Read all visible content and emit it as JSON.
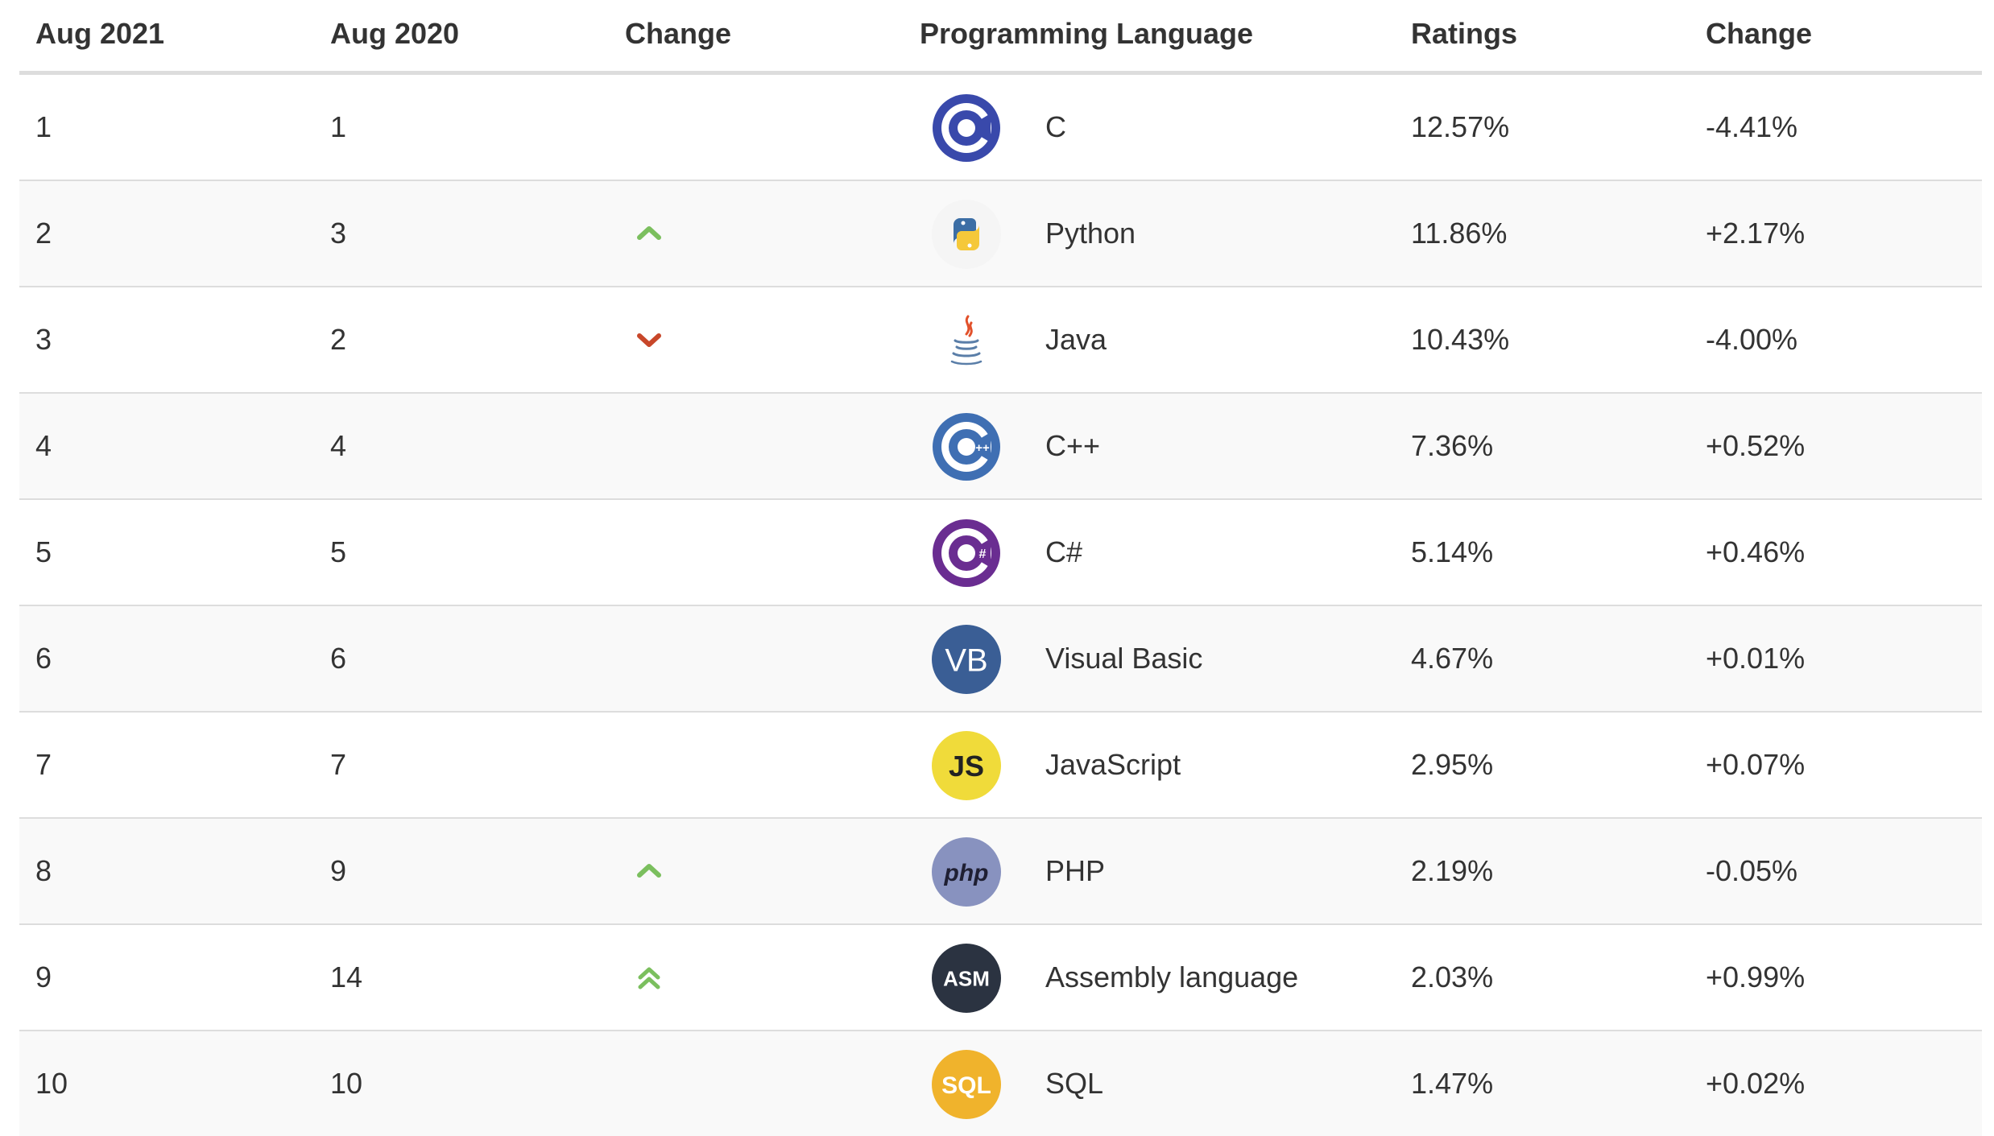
{
  "headers": {
    "col1": "Aug 2021",
    "col2": "Aug 2020",
    "col3": "Change",
    "col4": "Programming Language",
    "col5": "Ratings",
    "col6": "Change"
  },
  "colors": {
    "up": "#7bbf5e",
    "down": "#c8472a"
  },
  "rows": [
    {
      "rank": "1",
      "prev": "1",
      "change_icon": "none",
      "logo": "c-logo-icon",
      "language": "C",
      "rating": "12.57%",
      "change": "-4.41%"
    },
    {
      "rank": "2",
      "prev": "3",
      "change_icon": "chevron-up-icon",
      "logo": "python-logo-icon",
      "language": "Python",
      "rating": "11.86%",
      "change": "+2.17%"
    },
    {
      "rank": "3",
      "prev": "2",
      "change_icon": "chevron-down-icon",
      "logo": "java-logo-icon",
      "language": "Java",
      "rating": "10.43%",
      "change": "-4.00%"
    },
    {
      "rank": "4",
      "prev": "4",
      "change_icon": "none",
      "logo": "cpp-logo-icon",
      "language": "C++",
      "rating": "7.36%",
      "change": "+0.52%"
    },
    {
      "rank": "5",
      "prev": "5",
      "change_icon": "none",
      "logo": "csharp-logo-icon",
      "language": "C#",
      "rating": "5.14%",
      "change": "+0.46%"
    },
    {
      "rank": "6",
      "prev": "6",
      "change_icon": "none",
      "logo": "vb-logo-icon",
      "logo_text": "VB",
      "language": "Visual Basic",
      "rating": "4.67%",
      "change": "+0.01%"
    },
    {
      "rank": "7",
      "prev": "7",
      "change_icon": "none",
      "logo": "javascript-logo-icon",
      "logo_text": "JS",
      "language": "JavaScript",
      "rating": "2.95%",
      "change": "+0.07%"
    },
    {
      "rank": "8",
      "prev": "9",
      "change_icon": "chevron-up-icon",
      "logo": "php-logo-icon",
      "logo_text": "php",
      "language": "PHP",
      "rating": "2.19%",
      "change": "-0.05%"
    },
    {
      "rank": "9",
      "prev": "14",
      "change_icon": "double-chevron-up-icon",
      "logo": "assembly-logo-icon",
      "logo_text": "ASM",
      "language": "Assembly language",
      "rating": "2.03%",
      "change": "+0.99%"
    },
    {
      "rank": "10",
      "prev": "10",
      "change_icon": "none",
      "logo": "sql-logo-icon",
      "logo_text": "SQL",
      "language": "SQL",
      "rating": "1.47%",
      "change": "+0.02%"
    }
  ]
}
